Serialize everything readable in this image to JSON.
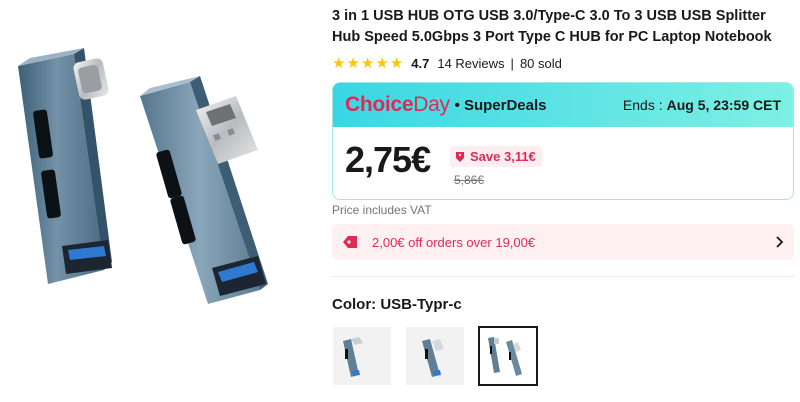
{
  "product": {
    "title": "3 in 1 USB HUB OTG USB 3.0/Type-C 3.0 To 3 USB USB Splitter Hub Speed 5.0Gbps 3 Port Type C HUB for PC Laptop Notebook",
    "rating_value": "4.7",
    "rating_stars": 4.7,
    "reviews": "14 Reviews",
    "separator": "|",
    "sold": "80 sold",
    "main_image_icon": "usb-hub-photo"
  },
  "promo": {
    "brand_choice": "Choice",
    "brand_day": "Day",
    "dot": "•",
    "superdeals": "SuperDeals",
    "ends_label": "Ends :",
    "ends_time": "Aug 5, 23:59 CET",
    "price": "2,75€",
    "save_label": "Save 3,11€",
    "original_price": "5,86€",
    "colors": {
      "brand": "#e02a56",
      "accent": "#3ad6e4"
    }
  },
  "vat_note": "Price includes VAT",
  "coupon": {
    "text": "2,00€ off orders over 19,00€",
    "icon": "tag-icon",
    "chevron": "chevron-right-icon"
  },
  "variant": {
    "color_label": "Color: USB-Typr-c",
    "options": [
      {
        "name": "variant-1",
        "selected": false
      },
      {
        "name": "variant-2",
        "selected": false
      },
      {
        "name": "variant-3",
        "selected": true
      }
    ]
  }
}
